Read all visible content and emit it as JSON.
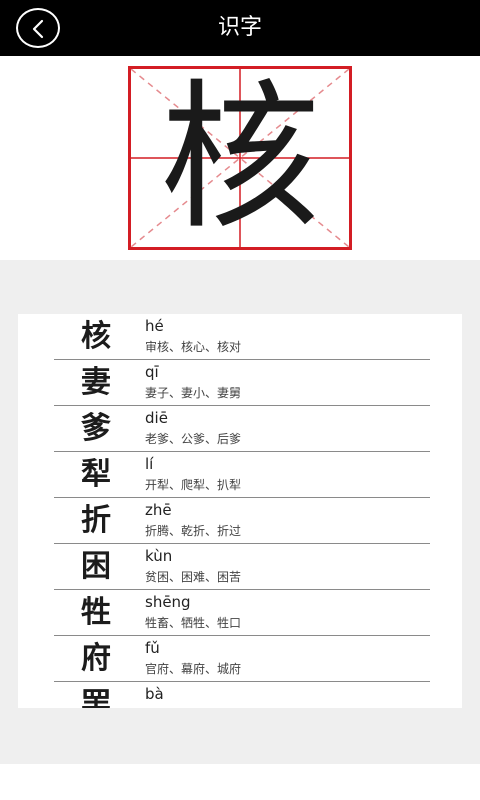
{
  "header": {
    "title": "识字"
  },
  "character": {
    "glyph": "核"
  },
  "colors": {
    "grid_red": "#d31d24",
    "header_bg": "#000000"
  },
  "list": [
    {
      "char": "核",
      "pinyin": "hé",
      "words": "审核、核心、核对"
    },
    {
      "char": "妻",
      "pinyin": "qī",
      "words": "妻子、妻小、妻舅"
    },
    {
      "char": "爹",
      "pinyin": "diē",
      "words": "老爹、公爹、后爹"
    },
    {
      "char": "犁",
      "pinyin": "lí",
      "words": "开犁、爬犁、扒犁"
    },
    {
      "char": "折",
      "pinyin": "zhē",
      "words": "折腾、乾折、折过"
    },
    {
      "char": "困",
      "pinyin": "kùn",
      "words": "贫困、困难、困苦"
    },
    {
      "char": "牲",
      "pinyin": "shēng",
      "words": "牲畜、牺牲、牲口"
    },
    {
      "char": "府",
      "pinyin": "fǔ",
      "words": "官府、幕府、城府"
    },
    {
      "char": "罢",
      "pinyin": "bà",
      "words": ""
    }
  ]
}
